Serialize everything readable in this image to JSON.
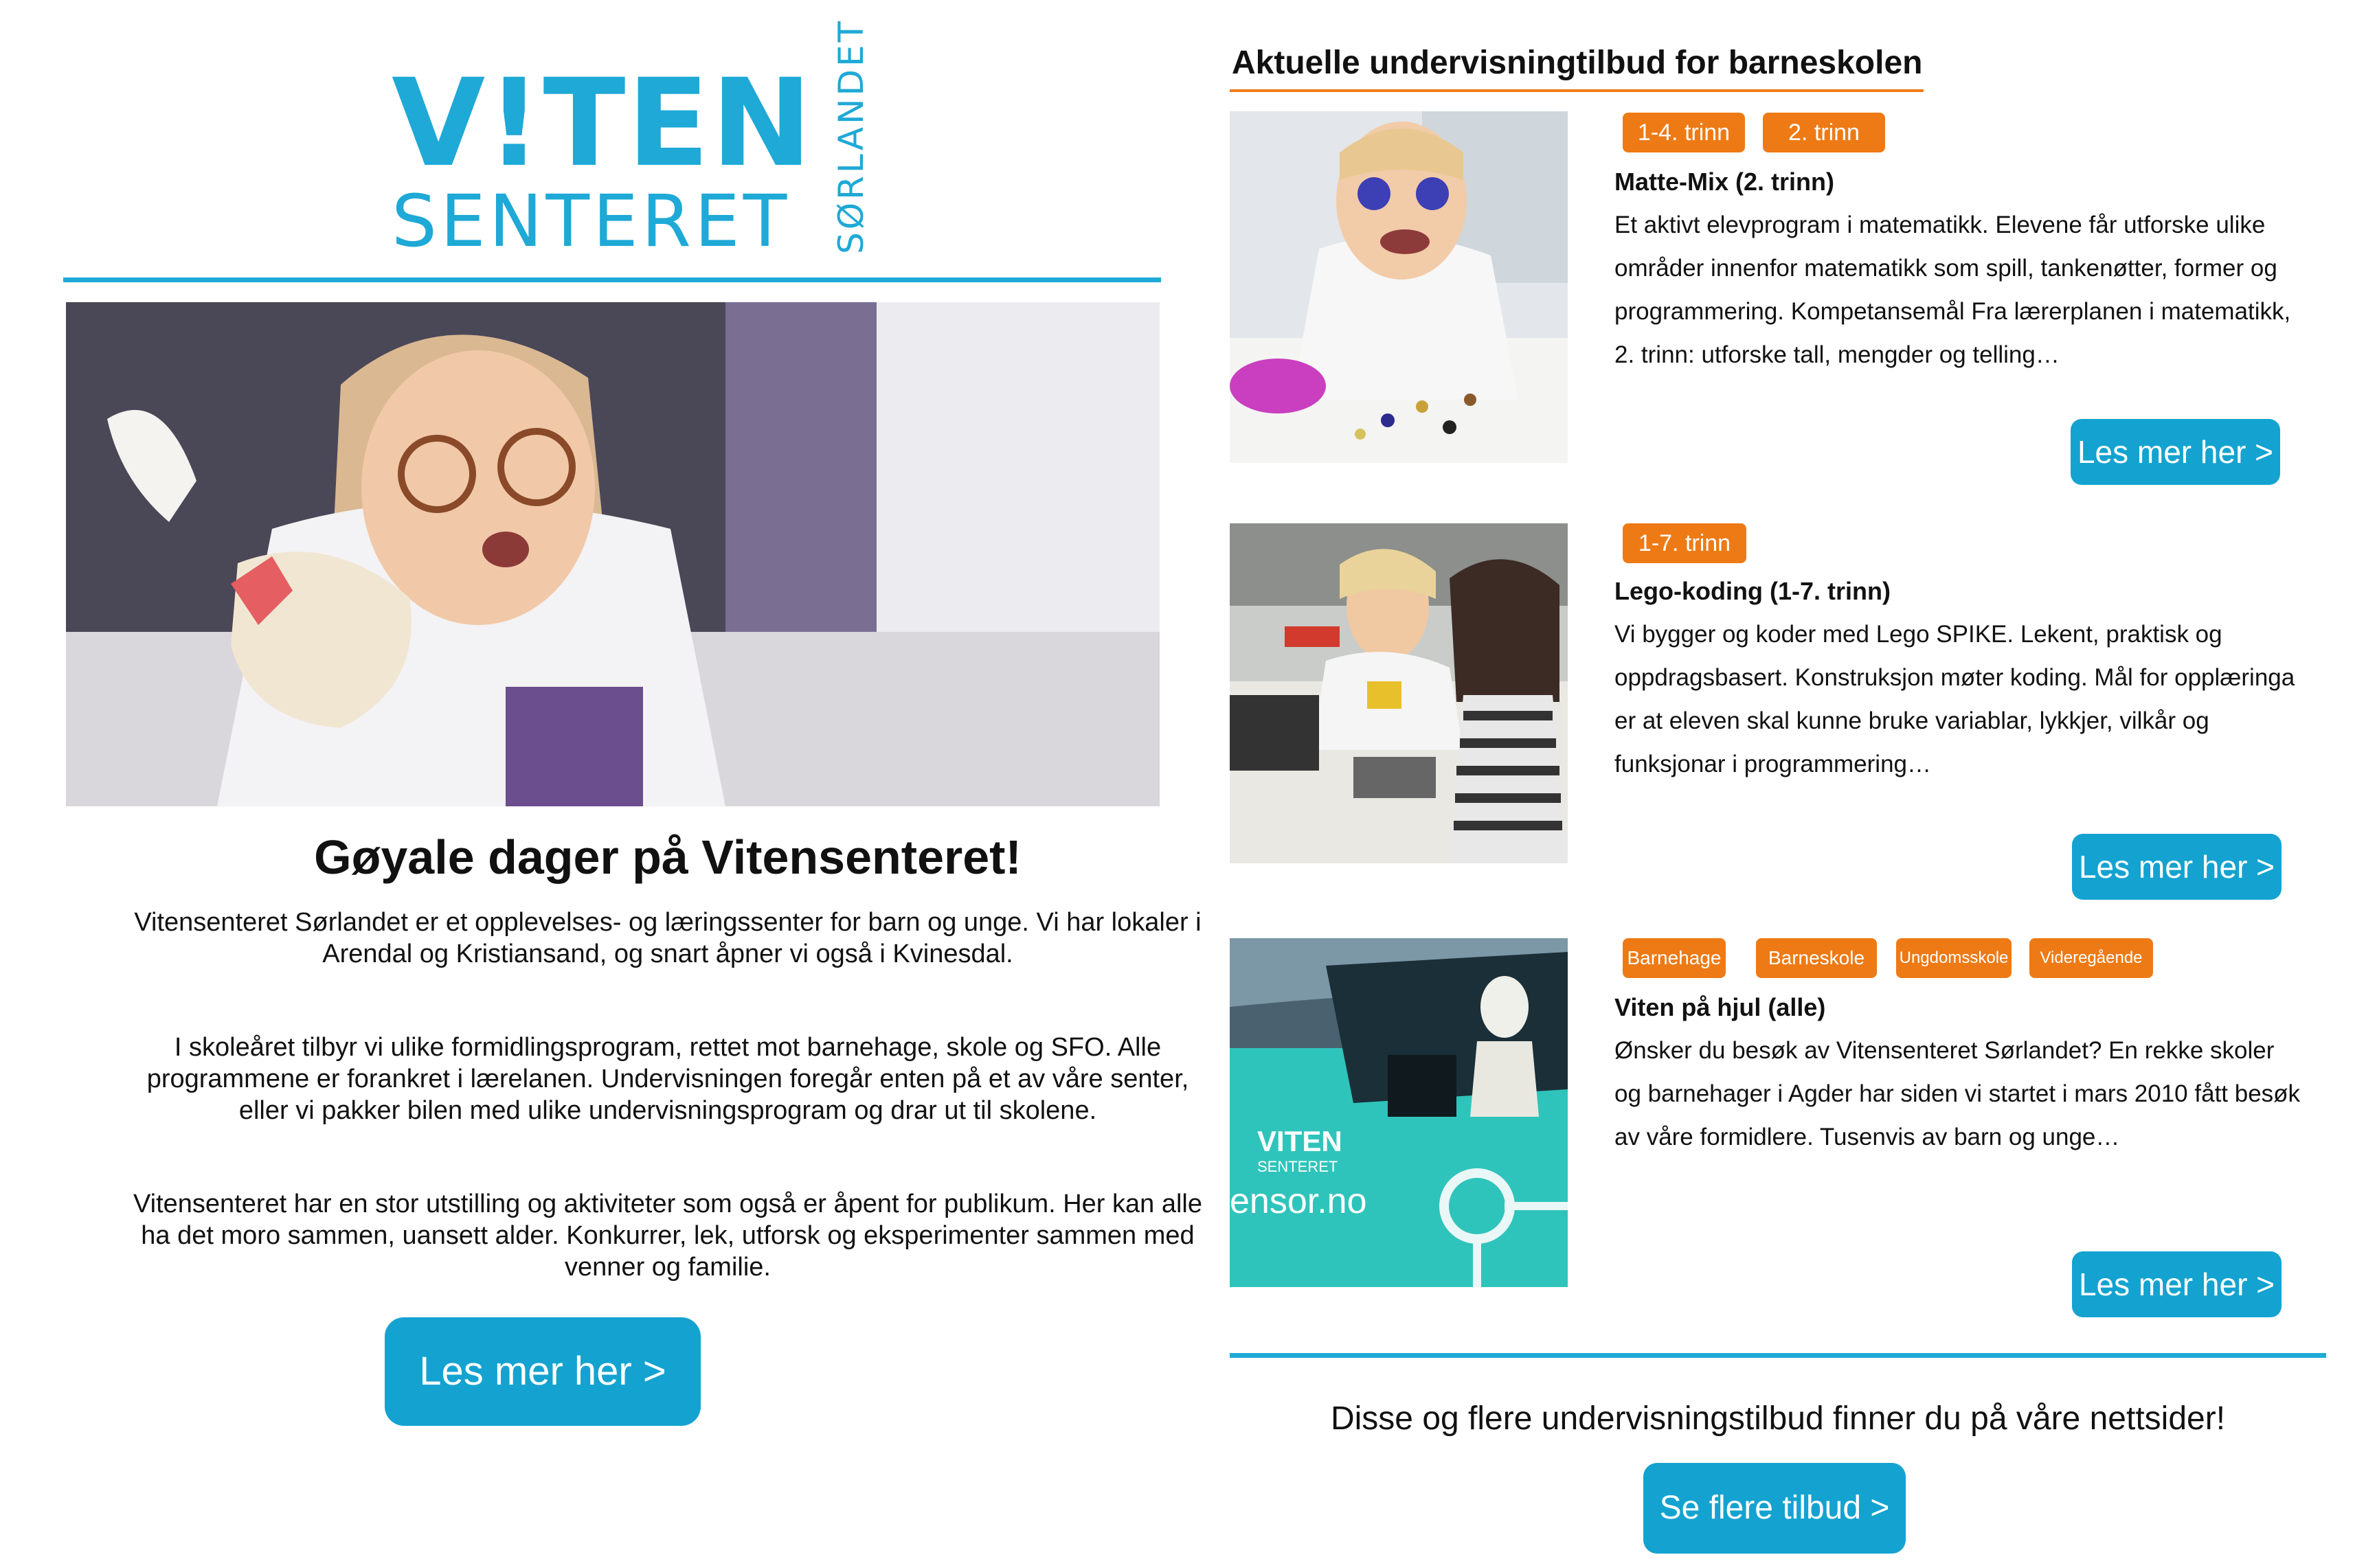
{
  "logo": {
    "top": "V!TEN",
    "bottom": "SENTERET",
    "side": "SØRLANDET"
  },
  "left": {
    "title": "Gøyale dager på Vitensenteret!",
    "paragraphs": [
      "Vitensenteret Sørlandet er et opplevelses- og læringssenter for barn og unge. Vi har lokaler i Arendal og Kristiansand, og snart åpner vi også i Kvinesdal.",
      "I skoleåret tilbyr vi ulike formidlingsprogram, rettet mot barnehage, skole og SFO. Alle programmene er forankret i lærelanen. Undervisningen foregår enten på et av våre senter, eller vi pakker bilen med ulike undervisningsprogram og drar ut til skolene.",
      "Vitensenteret har en stor utstilling og aktiviteter som også er åpent for publikum. Her kan alle ha det moro sammen, uansett alder. Konkurrer, lek, utforsk og eksperimenter sammen med venner og familie."
    ],
    "button": "Les mer her >"
  },
  "right": {
    "heading": "Aktuelle undervisningtilbud for barneskolen",
    "cards": [
      {
        "tags": [
          "1-4. trinn",
          "2. trinn"
        ],
        "title": "Matte-Mix (2. trinn)",
        "text": "Et aktivt elevprogram i matematikk. Elevene får utforske ulike områder innenfor matematikk som spill, tankenøtter, former og programmering. Kompetansemål Fra lærerplanen i matematikk, 2. trinn: utforske tall, mengder og telling…",
        "button": "Les mer her >"
      },
      {
        "tags": [
          "1-7. trinn"
        ],
        "title": "Lego-koding (1-7. trinn)",
        "text": "Vi bygger og koder med Lego SPIKE. Lekent, praktisk og oppdragsbasert. Konstruksjon møter koding. Mål for opplæringa er at eleven skal kunne bruke variablar, lykkjer, vilkår og funksjonar i programmering…",
        "button": "Les mer her >"
      },
      {
        "tags": [
          "Barnehage",
          "Barneskole",
          "Ungdomsskole",
          "Videregående"
        ],
        "title": "Viten på hjul (alle)",
        "text": "Ønsker du besøk av Vitensenteret Sørlandet? En rekke skoler og barnehager i Agder har siden vi startet i mars 2010 fått besøk av våre formidlere. Tusenvis av barn og unge…",
        "button": "Les mer her >",
        "image_text": {
          "brand_top": "VITEN",
          "brand_bottom": "SENTERET",
          "url": "ensor.no"
        }
      }
    ],
    "footer_text": "Disse og flere undervisningstilbud finner du på våre nettsider!",
    "footer_button": "Se flere tilbud >"
  },
  "colors": {
    "brand_blue": "#1ea9d6",
    "button_blue": "#14a3d0",
    "tag_orange": "#ee7a15"
  }
}
